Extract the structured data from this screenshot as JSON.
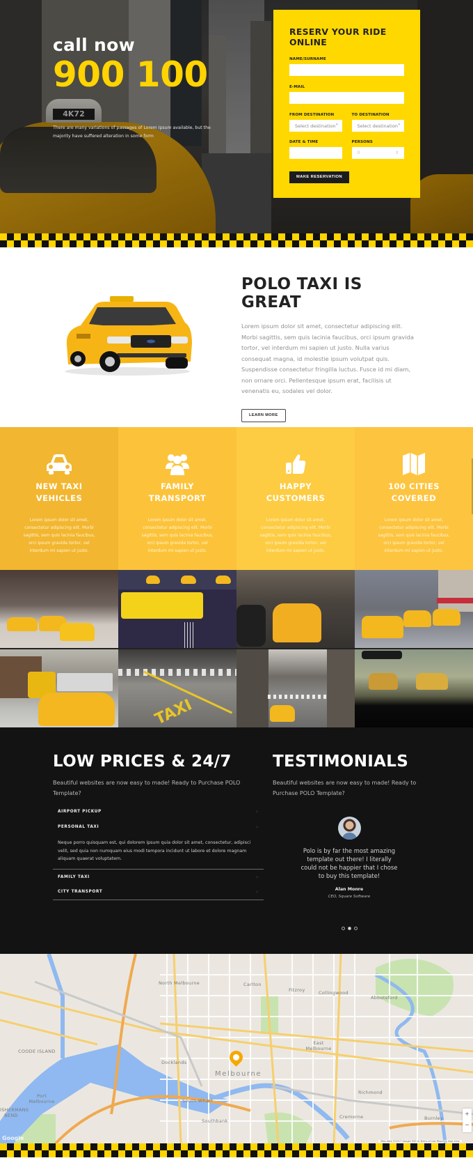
{
  "hero": {
    "call_label": "call now",
    "phone": "900 100",
    "description": "There are many variations of passages of Lorem Ipsum available, but the majority have suffered alteration in some form",
    "taxi_sign": "4K72"
  },
  "booking": {
    "title": "RESERV YOUR RIDE ONLINE",
    "name_label": "NAME/SURNAME",
    "name_value": "",
    "email_label": "E-MAIL",
    "email_value": "",
    "from_label": "FROM DESTINATION",
    "from_placeholder": "Select destination",
    "to_label": "TO DESTINATION",
    "to_placeholder": "Select destination",
    "date_label": "DATE & TIME",
    "date_value": "",
    "persons_label": "PERSONS",
    "persons_value": "0",
    "submit_label": "MAKE RESERVATION"
  },
  "about": {
    "title": "POLO TAXI IS GREAT",
    "body": "Lorem ipsum dolor sit amet, consectetur adipiscing elit. Morbi sagittis, sem quis lacinia faucibus, orci ipsum gravida tortor, vel interdum mi sapien ut justo. Nulla varius consequat magna, id molestie ipsum volutpat quis. Suspendisse consectetur fringilla luctus. Fusce id mi diam, non ornare orci. Pellentesque ipsum erat, facilisis ut venenatis eu, sodales vel dolor.",
    "button_label": "LEARN MORE"
  },
  "features": [
    {
      "icon": "car-icon",
      "line1": "NEW TAXI",
      "line2": "VEHICLES",
      "body": "Lorem ipsum dolor sit amet, consectetur adipiscing elit. Morbi sagittis, sem quis lacinia faucibus, orci ipsum gravida tortor, vel interdum mi sapien ut justo."
    },
    {
      "icon": "users-icon",
      "line1": "FAMILY",
      "line2": "TRANSPORT",
      "body": "Lorem ipsum dolor sit amet, consectetur adipiscing elit. Morbi sagittis, sem quis lacinia faucibus, orci ipsum gravida tortor, vel interdum mi sapien ut justo."
    },
    {
      "icon": "thumbs-up-icon",
      "line1": "HAPPY",
      "line2": "CUSTOMERS",
      "body": "Lorem ipsum dolor sit amet, consectetur adipiscing elit. Morbi sagittis, sem quis lacinia faucibus, orci ipsum gravida tortor, vel interdum mi sapien ut justo."
    },
    {
      "icon": "map-icon",
      "line1": "100 CITIES",
      "line2": "COVERED",
      "body": "Lorem ipsum dolor sit amet, consectetur adipiscing elit. Morbi sagittis, sem quis lacinia faucibus, orci ipsum gravida tortor, vel interdum mi sapien ut justo."
    }
  ],
  "gallery": {
    "count": 8,
    "subjects": [
      "taxis on city street",
      "yellow bus from above",
      "taxi in traffic",
      "taxis at intersection",
      "taxis and truck",
      "taxi road marking with cyclist",
      "taxi on avenue",
      "taxi through windshield"
    ]
  },
  "prices": {
    "title": "LOW PRICES & 24/7",
    "lead": "Beautiful websites are now easy to made! Ready to Purchase POLO Template?",
    "accordion": [
      {
        "title": "AIRPORT PICKUP",
        "expanded": false
      },
      {
        "title": "PERSONAL TAXI",
        "expanded": true,
        "body": "Neque porro quisquam est, qui dolorem ipsum quia dolor sit amet, consectetur, adipisci velit, sed quia non numquam eius modi tempora incidunt ut labore et dolore magnam aliquam quaerat voluptatem."
      },
      {
        "title": "FAMILY TAXI",
        "expanded": false
      },
      {
        "title": "CITY TRANSPORT",
        "expanded": false
      }
    ],
    "chevron": "›"
  },
  "testimonials": {
    "title": "TESTIMONIALS",
    "lead": "Beautiful websites are now easy to made! Ready to Purchase POLO Template?",
    "quote": "Polo is by far the most amazing template out there! I literally could not be happier that I chose to buy this template!",
    "author": "Alan Monre",
    "role": "CEO, Square Software",
    "slides": 3,
    "active_slide": 2
  },
  "map": {
    "center_label": "Melbourne",
    "labels": [
      "North Melbourne",
      "Carlton",
      "Fitzroy",
      "Collingwood",
      "Abbotsford",
      "East Melbourne",
      "Docklands",
      "COODE ISLAND",
      "Port Melbourne",
      "FISHERMANS BEND",
      "South Wharf",
      "Southbank",
      "Richmond",
      "Cremorne",
      "Burnley"
    ],
    "zoom_in": "+",
    "zoom_out": "−",
    "provider": "Google",
    "attribution": "Map data ©2017 Google   500 m   Terms of Use   Report a map error"
  },
  "colors": {
    "brand_yellow": "#ffd800",
    "dark": "#131313"
  }
}
